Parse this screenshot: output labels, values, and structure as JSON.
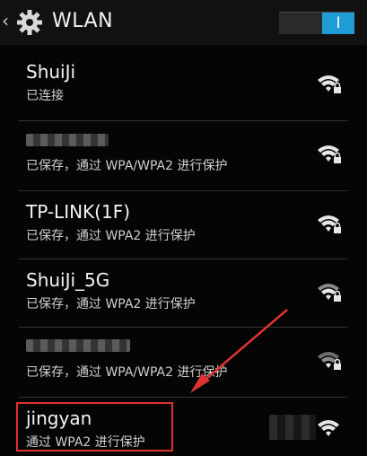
{
  "header": {
    "back_icon": "‹",
    "title": "WLAN",
    "toggle_label": "I",
    "accent_color": "#1f9bd6"
  },
  "networks": [
    {
      "name": "ShuiJi",
      "status": "已连接"
    },
    {
      "name": "",
      "status": "已保存，通过 WPA/WPA2 进行保护"
    },
    {
      "name": "TP-LINK(1F)",
      "status": "已保存，通过 WPA2 进行保护"
    },
    {
      "name": "ShuiJi_5G",
      "status": "已保存，通过 WPA2 进行保护"
    },
    {
      "name": "",
      "status": "已保存，通过 WPA/WPA2 进行保护"
    },
    {
      "name": "jingyan",
      "status": "通过 WPA2 进行保护"
    }
  ],
  "annotation": {
    "color": "#e03232"
  }
}
